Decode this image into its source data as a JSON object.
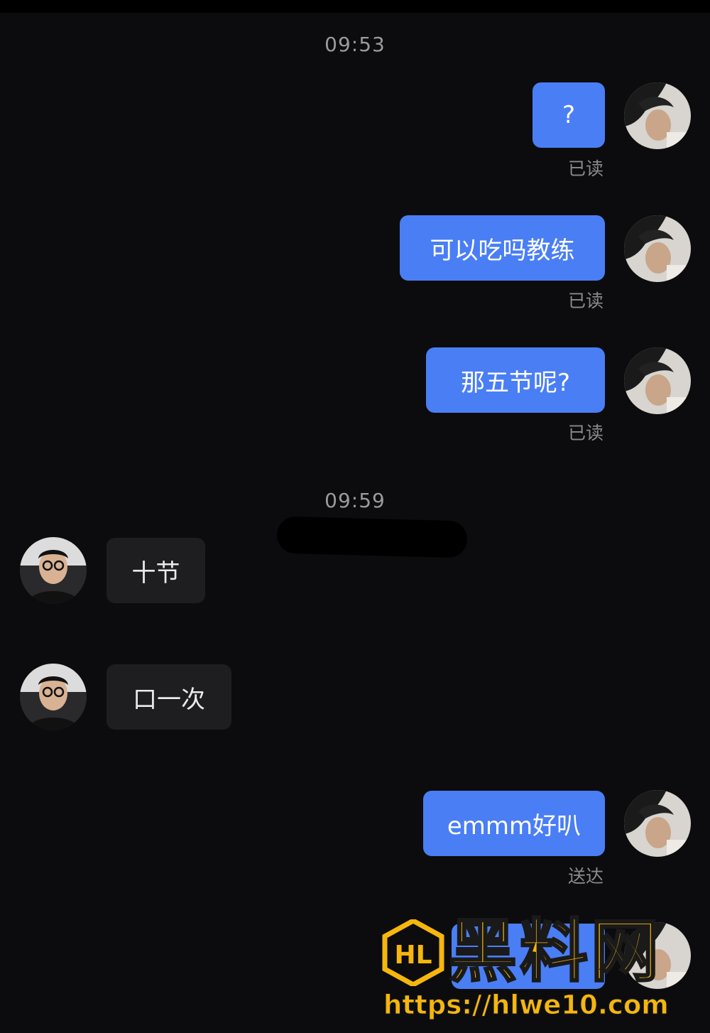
{
  "conversation": {
    "timestamps": [
      "09:53",
      "09:59"
    ],
    "messages": [
      {
        "side": "out",
        "text": "?",
        "status": "已读"
      },
      {
        "side": "out",
        "text": "可以吃吗教练",
        "status": "已读"
      },
      {
        "side": "out",
        "text": "那五节呢?",
        "status": "已读"
      },
      {
        "side": "in",
        "text": "十节"
      },
      {
        "side": "in",
        "text": "口一次"
      },
      {
        "side": "out",
        "text": "emmm好叭",
        "status": "送达"
      }
    ]
  },
  "watermark": {
    "logo_text": "HL",
    "title": "黑料网",
    "url": "https://hlwe10.com"
  },
  "colors": {
    "background": "#0c0c0e",
    "outgoing_bubble": "#4a7ef5",
    "incoming_bubble": "#1e1e21",
    "watermark": "#f5b60d"
  }
}
